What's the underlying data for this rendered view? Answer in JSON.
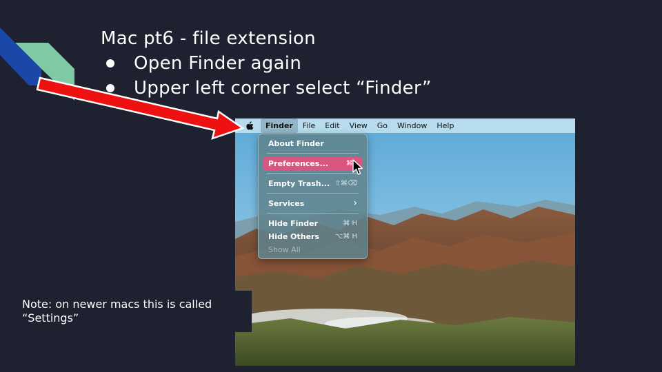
{
  "slide": {
    "title": "Mac pt6 - file extension",
    "bullets": [
      "Open Finder again",
      "Upper left corner select “Finder”"
    ],
    "note": "Note: on newer macs this is called “Settings”"
  },
  "screenshot": {
    "menubar": {
      "apple_icon": "apple-logo-icon",
      "items": [
        "Finder",
        "File",
        "Edit",
        "View",
        "Go",
        "Window",
        "Help"
      ],
      "active": "Finder"
    },
    "finder_menu": {
      "items": [
        {
          "label": "About Finder",
          "shortcut": ""
        },
        {
          "label": "Preferences...",
          "shortcut": "⌘ ,"
        },
        {
          "label": "Empty Trash...",
          "shortcut": "⇧⌘⌫"
        },
        {
          "label": "Services",
          "shortcut": "›"
        },
        {
          "label": "Hide Finder",
          "shortcut": "⌘ H"
        },
        {
          "label": "Hide Others",
          "shortcut": "⌥⌘ H"
        },
        {
          "label": "Show All",
          "shortcut": ""
        }
      ],
      "highlighted": "Preferences..."
    }
  },
  "colors": {
    "background": "#1d2130",
    "arrow": "#ee1111",
    "highlight": "#d9567f",
    "corner_blue": "#1b47a8",
    "corner_green": "#7fc9a4"
  }
}
